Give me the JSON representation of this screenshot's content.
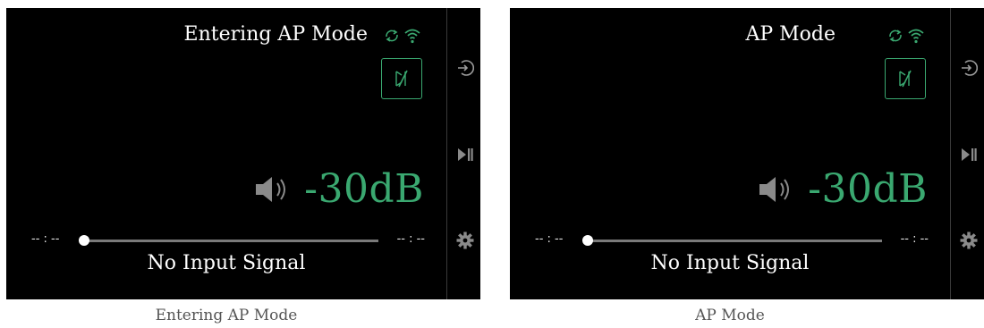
{
  "panels": [
    {
      "status_text": "Entering AP Mode",
      "volume": "-30dB",
      "time_elapsed": "-- : --",
      "time_total": "-- : --",
      "signal_status": "No Input Signal",
      "caption": "Entering AP Mode"
    },
    {
      "status_text": "AP Mode",
      "volume": "-30dB",
      "time_elapsed": "-- : --",
      "time_total": "-- : --",
      "signal_status": "No Input Signal",
      "caption": "AP Mode"
    }
  ],
  "colors": {
    "accent": "#3aa870",
    "background": "#000000",
    "text": "#ffffff"
  },
  "icons": [
    "sync-icon",
    "wifi-icon",
    "mute-icon",
    "speaker-icon",
    "input-icon",
    "play-pause-icon",
    "gear-icon"
  ]
}
